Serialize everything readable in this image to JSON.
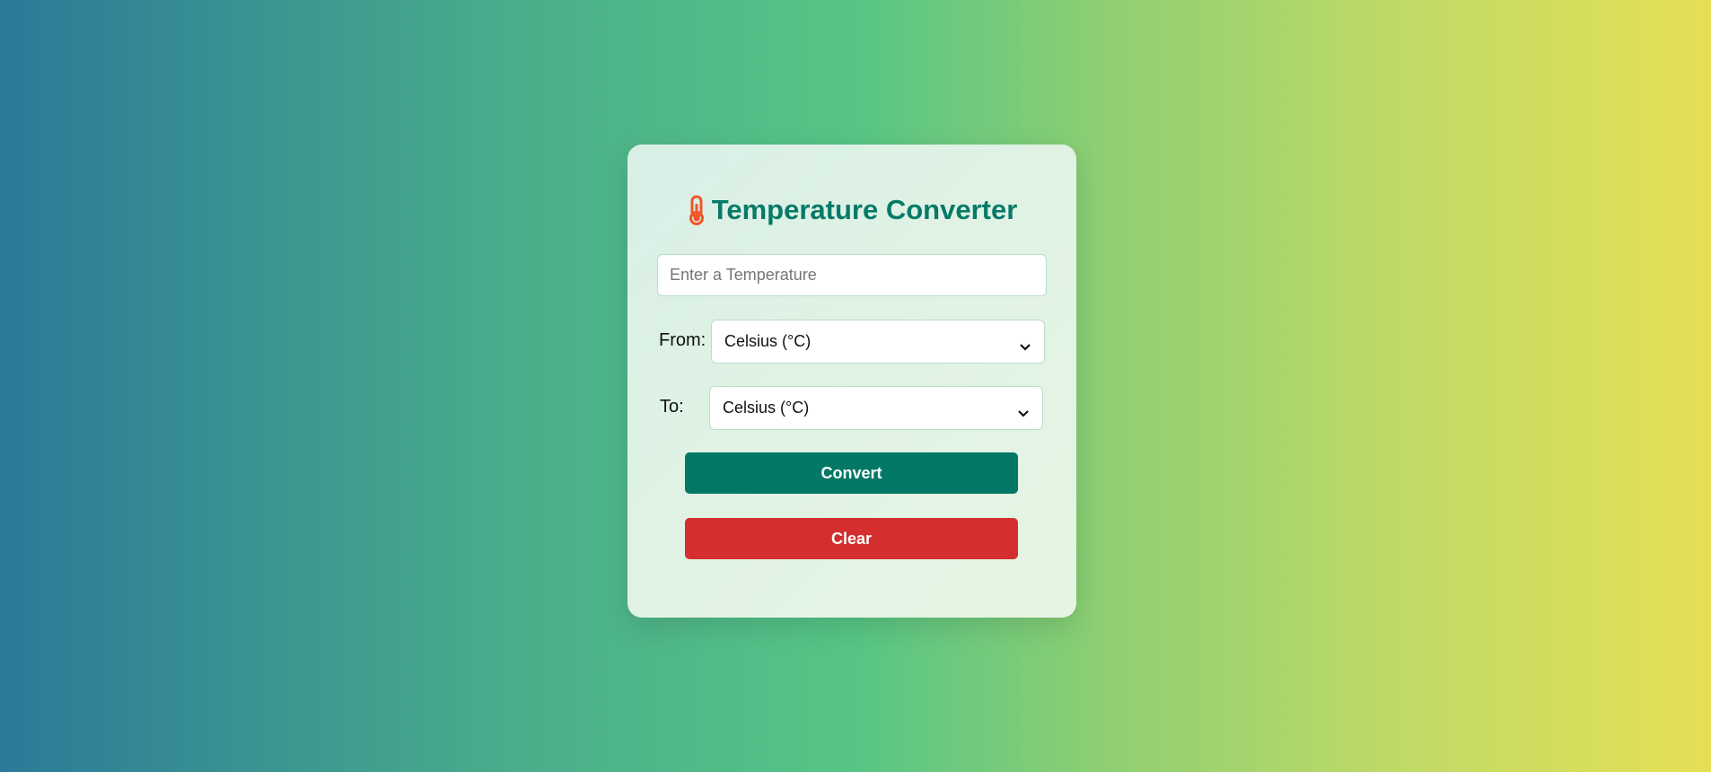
{
  "title": "Temperature Converter",
  "icons": {
    "title_icon": "thermometer-icon"
  },
  "input": {
    "placeholder": "Enter a Temperature",
    "value": ""
  },
  "from": {
    "label": "From:",
    "selected": "Celsius (°C)"
  },
  "to": {
    "label": "To:",
    "selected": "Celsius (°C)"
  },
  "buttons": {
    "convert": "Convert",
    "clear": "Clear"
  },
  "colors": {
    "accent": "#047866",
    "danger": "#d42e2e",
    "title": "#067a68",
    "icon": "#f0562a"
  }
}
